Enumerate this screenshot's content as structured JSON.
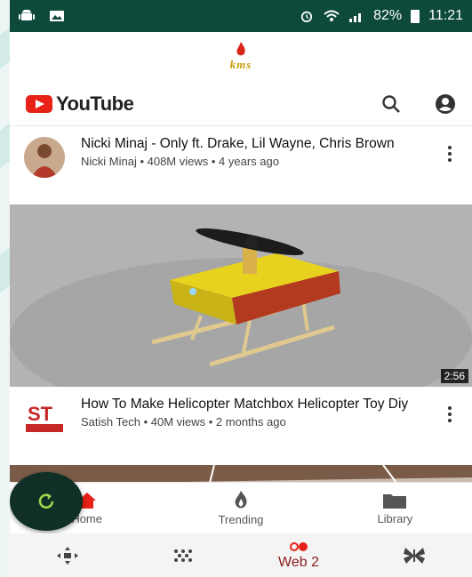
{
  "status_bar": {
    "battery_percent": "82%",
    "time": "11:21"
  },
  "app_header": {
    "logo_text": "kms"
  },
  "youtube": {
    "logo_text": "YouTube",
    "brand_color": "#e62117",
    "videos": [
      {
        "title": "Nicki Minaj - Only ft. Drake, Lil Wayne, Chris Brown",
        "channel_line": "Nicki Minaj • 408M views • 4 years ago"
      },
      {
        "title": "How To Make Helicopter Matchbox Helicopter Toy Diy",
        "channel_line": "Satish Tech • 40M views • 2 months ago",
        "duration": "2:56"
      }
    ],
    "tabs": [
      {
        "label": "Home",
        "icon": "home-icon"
      },
      {
        "label": "Trending",
        "icon": "flame-icon"
      },
      {
        "label": "Library",
        "icon": "folder-icon"
      }
    ]
  },
  "app_nav": {
    "items": [
      {
        "icon": "move-arrows-icon",
        "label": ""
      },
      {
        "icon": "dots-grid-icon",
        "label": ""
      },
      {
        "icon": "web2-icon",
        "label": "Web 2"
      },
      {
        "icon": "butterfly-icon",
        "label": ""
      }
    ],
    "active_color": "#8a1b1b"
  }
}
